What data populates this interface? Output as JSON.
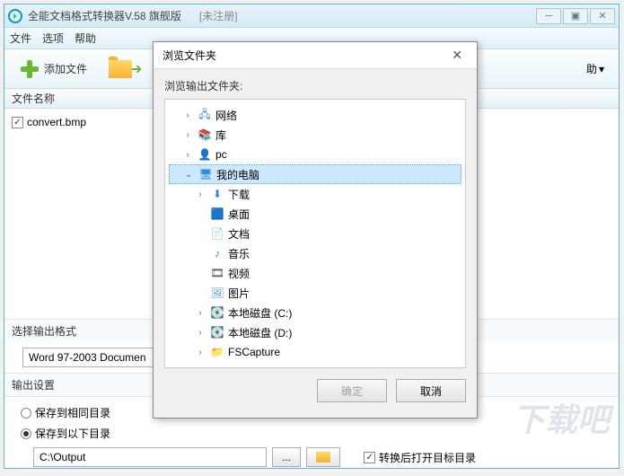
{
  "window": {
    "title": "全能文档格式转换器V.58 旗舰版",
    "status": "[未注册]"
  },
  "menubar": {
    "file": "文件",
    "option": "选项",
    "help": "帮助"
  },
  "toolbar": {
    "add_file": "添加文件",
    "help_drop": "助"
  },
  "columns": {
    "filename": "文件名称"
  },
  "files": [
    {
      "name": "convert.bmp",
      "checked": true
    }
  ],
  "format": {
    "label": "选择输出格式",
    "selected": "Word 97-2003 Documen"
  },
  "output": {
    "label": "输出设置",
    "same_dir": "保存到相同目录",
    "below_dir": "保存到以下目录",
    "path": "C:\\Output",
    "browse": "...",
    "open_after": "转换后打开目标目录"
  },
  "watermark": "下载吧",
  "dialog": {
    "title": "浏览文件夹",
    "label": "浏览输出文件夹:",
    "ok": "确定",
    "cancel": "取消",
    "tree": [
      {
        "indent": 1,
        "tw": "›",
        "icon": "net",
        "label": "网络"
      },
      {
        "indent": 1,
        "tw": "›",
        "icon": "lib",
        "label": "库"
      },
      {
        "indent": 1,
        "tw": "›",
        "icon": "pc",
        "label": "pc"
      },
      {
        "indent": 1,
        "tw": "⌄",
        "icon": "mon",
        "label": "我的电脑",
        "sel": true
      },
      {
        "indent": 2,
        "tw": "›",
        "icon": "dl",
        "label": "下载"
      },
      {
        "indent": 2,
        "tw": "",
        "icon": "desk",
        "label": "桌面"
      },
      {
        "indent": 2,
        "tw": "",
        "icon": "doc",
        "label": "文档"
      },
      {
        "indent": 2,
        "tw": "",
        "icon": "mus",
        "label": "音乐"
      },
      {
        "indent": 2,
        "tw": "",
        "icon": "vid",
        "label": "视频"
      },
      {
        "indent": 2,
        "tw": "",
        "icon": "pic",
        "label": "图片"
      },
      {
        "indent": 2,
        "tw": "›",
        "icon": "drv",
        "label": "本地磁盘 (C:)"
      },
      {
        "indent": 2,
        "tw": "›",
        "icon": "drv",
        "label": "本地磁盘 (D:)"
      },
      {
        "indent": 2,
        "tw": "›",
        "icon": "fld",
        "label": "FSCapture"
      }
    ]
  }
}
